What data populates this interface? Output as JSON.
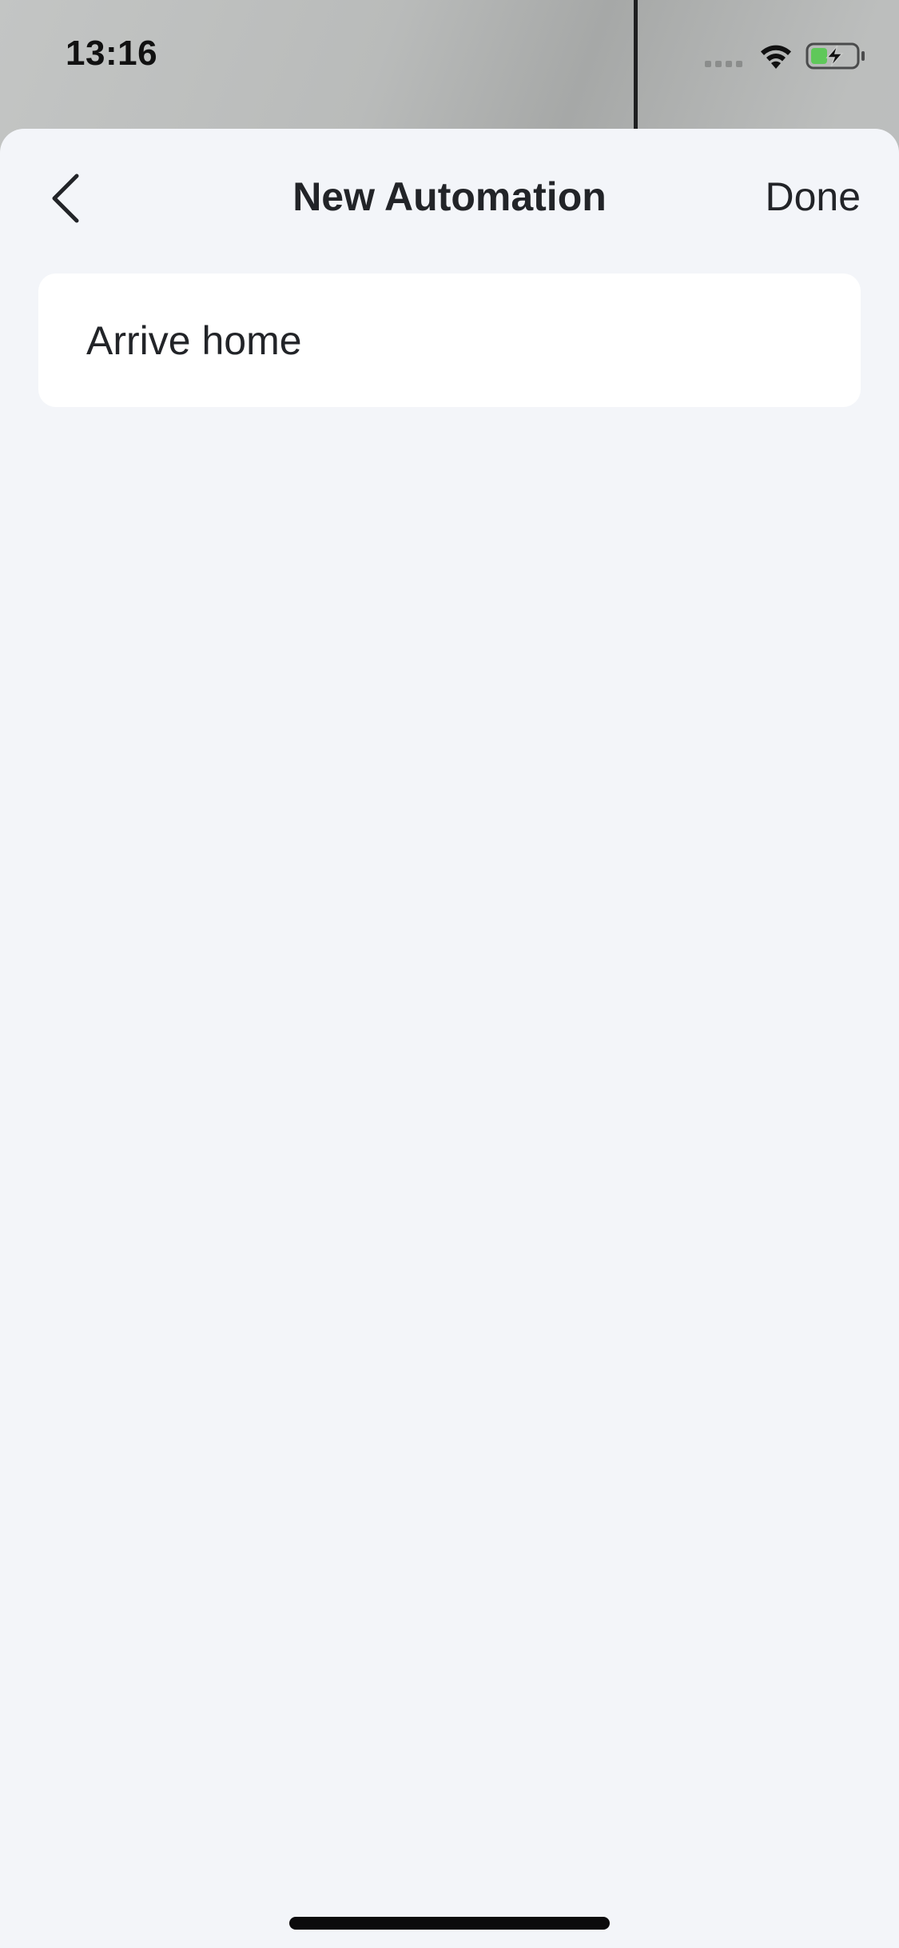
{
  "status_bar": {
    "time": "13:16",
    "signal_icon": "cellular-signal-icon",
    "wifi_icon": "wifi-icon",
    "battery_icon": "battery-charging-icon",
    "battery_color": "#5fc85a"
  },
  "nav": {
    "back_icon": "chevron-left-icon",
    "title": "New Automation",
    "done_label": "Done"
  },
  "automation": {
    "name_value": "Arrive home"
  },
  "colors": {
    "sheet_background": "#f3f5f9",
    "card_background": "#ffffff",
    "text": "#222428"
  }
}
